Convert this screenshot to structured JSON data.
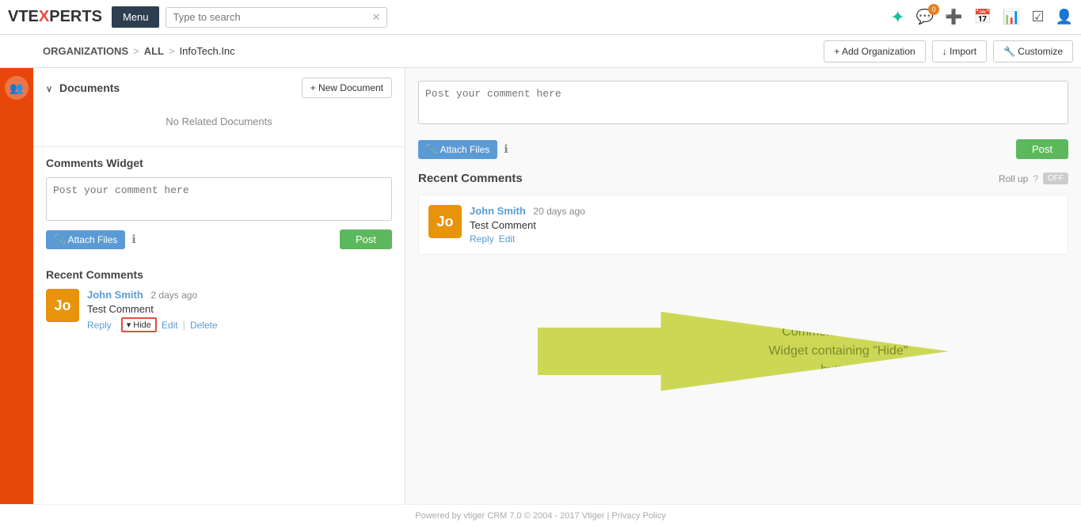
{
  "nav": {
    "logo_text": "VTE",
    "logo_x": "X",
    "logo_perts": "PERTS",
    "menu_label": "Menu",
    "search_placeholder": "Type to search",
    "notification_count": "0",
    "icons": [
      "notifications",
      "add",
      "calendar",
      "chart",
      "checklist",
      "user"
    ]
  },
  "breadcrumb": {
    "root": "ORGANIZATIONS",
    "sep1": ">",
    "all": "All",
    "sep2": ">",
    "current": "InfoTech.Inc"
  },
  "sub_actions": {
    "add_org": "+ Add Organization",
    "import": "↓ Import",
    "customize": "🔧 Customize"
  },
  "documents_section": {
    "title": "Documents",
    "new_doc_label": "+ New Document",
    "no_docs": "No Related Documents"
  },
  "left_comments": {
    "widget_title": "Comments Widget",
    "textarea_placeholder": "Post your comment here",
    "attach_label": "📎 Attach Files",
    "post_label": "Post",
    "recent_title": "Recent Comments",
    "comment": {
      "author": "John Smith",
      "time": "2 days ago",
      "text": "Test Comment",
      "hide_label": "▾ Hide",
      "reply_label": "Reply",
      "edit_label": "Edit",
      "delete_label": "Delete",
      "avatar": "Jo"
    }
  },
  "right_comments": {
    "textarea_placeholder": "Post your comment here",
    "attach_label": "📎 Attach Files",
    "post_label": "Post",
    "recent_title": "Recent Comments",
    "rollup_label": "Roll up",
    "toggle_label": "OFF",
    "comment": {
      "author": "John Smith",
      "time": "20 days ago",
      "text": "Test Comment",
      "reply_label": "Reply",
      "edit_label": "Edit",
      "avatar": "Jo"
    }
  },
  "annotation": {
    "line1": "Comment Summary",
    "line2": "Widget containing \"Hide\"",
    "line3": "button"
  },
  "footer": {
    "text": "Powered by vtiger CRM  7.0  © 2004 - 2017  Vtiger  |  Privacy Policy"
  }
}
